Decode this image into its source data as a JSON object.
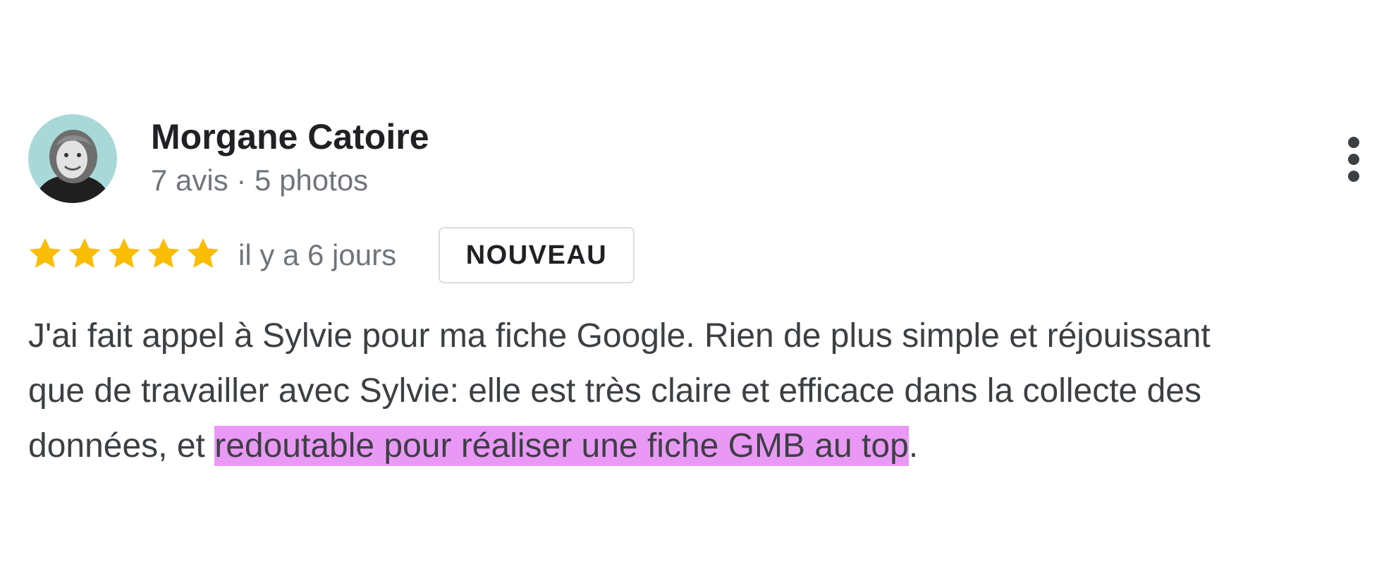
{
  "reviewer": {
    "name": "Morgane Catoire",
    "meta": "7 avis · 5 photos",
    "avatar_icon": "person-photo"
  },
  "menu": {
    "icon": "more-vert-icon"
  },
  "rating": {
    "stars": 5,
    "max": 5,
    "star_color": "#fbbc04",
    "date": "il y a 6 jours",
    "badge": "NOUVEAU"
  },
  "review": {
    "line1": "J'ai fait appel à Sylvie pour ma fiche Google. Rien de plus simple et réjouissant",
    "line2": "que de travailler avec Sylvie: elle est très claire et efficace dans la collecte des",
    "line3_start": "données, et ",
    "line3_highlight": "redoutable pour réaliser une fiche GMB au top",
    "line3_end": ".",
    "highlight_color": "#ea98f6"
  }
}
